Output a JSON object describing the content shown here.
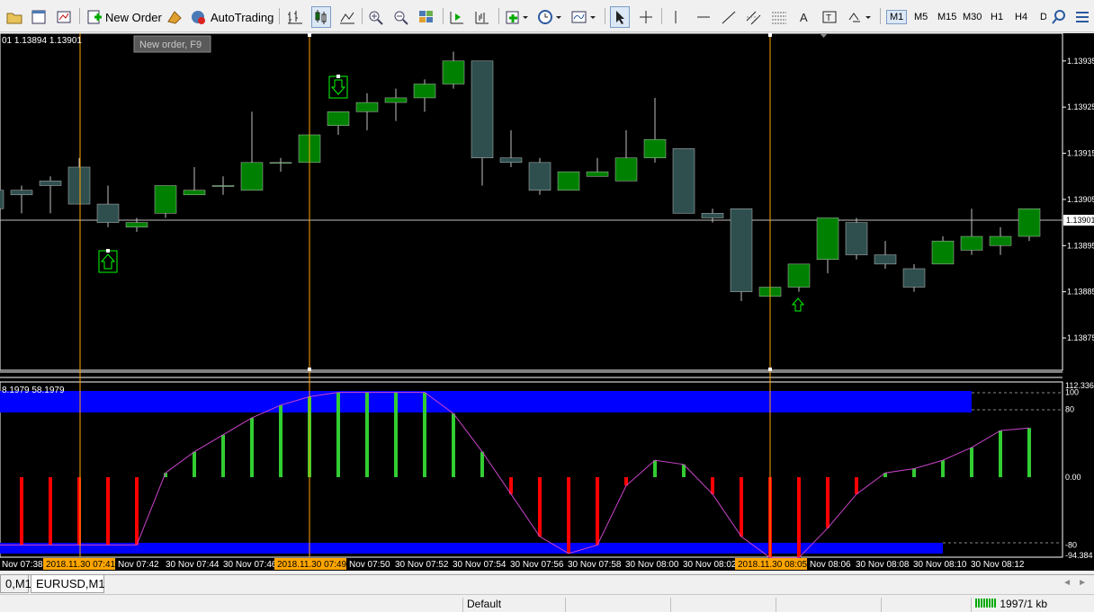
{
  "toolbar": {
    "new_order_label": "New Order",
    "autotrading_label": "AutoTrading",
    "timeframes": [
      "M1",
      "M5",
      "M15",
      "M30",
      "H1",
      "H4",
      "D"
    ],
    "active_timeframe": "M1"
  },
  "tooltip": "New order, F9",
  "chart": {
    "info_text": "01 1.13894 1.13901",
    "current_price": "1.13901",
    "price_labels": [
      "1.13935",
      "1.13925",
      "1.13915",
      "1.13905",
      "1.13895",
      "1.13885",
      "1.13875"
    ],
    "indicator_info": "8.1979 58.1979",
    "indicator_labels": [
      "112.336",
      "100",
      "80",
      "0.00",
      "-80",
      "-94.384"
    ],
    "time_labels": [
      "Nov 07:38",
      "Nov 07:42",
      "30 Nov 07:44",
      "30 Nov 07:46",
      "Nov 07:50",
      "30 Nov 07:52",
      "30 Nov 07:54",
      "30 Nov 07:56",
      "30 Nov 07:58",
      "30 Nov 08:00",
      "30 Nov 08:02",
      "Nov 08:06",
      "30 Nov 08:08",
      "30 Nov 08:10",
      "30 Nov 08:12"
    ],
    "highlighted_times": [
      "2018.11.30 07:41",
      "2018.11.30 07:49",
      "2018.11.30 08:05"
    ]
  },
  "tabs": [
    "0,M1",
    "EURUSD,M1"
  ],
  "status": {
    "profile": "Default",
    "traffic": "1997/1 kb"
  },
  "colors": {
    "bull": "#008000",
    "bear": "#2f4f4f",
    "band": "#0000ff",
    "hist_up": "#32cd32",
    "hist_down": "#ff0000",
    "vline": "#ffa500"
  },
  "chart_data": [
    {
      "type": "candlestick",
      "series": [
        {
          "name": "EURUSD,M1",
          "ohlc": [
            [
              1.13907,
              1.13907,
              1.13903,
              1.13903
            ],
            [
              1.13907,
              1.13908,
              1.13902,
              1.13906
            ],
            [
              1.13909,
              1.1391,
              1.13902,
              1.13908
            ],
            [
              1.13912,
              1.13914,
              1.13904,
              1.13904
            ],
            [
              1.13904,
              1.13908,
              1.13899,
              1.139
            ],
            [
              1.13899,
              1.13901,
              1.13898,
              1.139
            ],
            [
              1.13902,
              1.13908,
              1.13901,
              1.13908
            ],
            [
              1.13906,
              1.13912,
              1.13906,
              1.13907
            ],
            [
              1.13908,
              1.1391,
              1.13906,
              1.13908
            ],
            [
              1.13907,
              1.13924,
              1.13907,
              1.13913
            ],
            [
              1.13913,
              1.13914,
              1.13911,
              1.13913
            ],
            [
              1.13913,
              1.13919,
              1.13913,
              1.13919
            ],
            [
              1.13921,
              1.13923,
              1.13919,
              1.13924
            ],
            [
              1.13924,
              1.13928,
              1.1392,
              1.13926
            ],
            [
              1.13926,
              1.13929,
              1.13922,
              1.13927
            ],
            [
              1.13927,
              1.13931,
              1.13924,
              1.1393
            ],
            [
              1.1393,
              1.13937,
              1.13929,
              1.13935
            ],
            [
              1.13935,
              1.13935,
              1.13908,
              1.13914
            ],
            [
              1.13914,
              1.1392,
              1.13912,
              1.13913
            ],
            [
              1.13913,
              1.13914,
              1.13906,
              1.13907
            ],
            [
              1.13907,
              1.13911,
              1.13907,
              1.13911
            ],
            [
              1.1391,
              1.13914,
              1.1391,
              1.13911
            ],
            [
              1.13909,
              1.1392,
              1.13909,
              1.13914
            ],
            [
              1.13914,
              1.13927,
              1.13913,
              1.13918
            ],
            [
              1.13916,
              1.13916,
              1.13902,
              1.13902
            ],
            [
              1.13902,
              1.13903,
              1.139,
              1.13901
            ],
            [
              1.13903,
              1.13903,
              1.13883,
              1.13885
            ],
            [
              1.13884,
              1.13889,
              1.13883,
              1.13886
            ],
            [
              1.13886,
              1.13891,
              1.13885,
              1.13891
            ],
            [
              1.13892,
              1.13892,
              1.13889,
              1.13901
            ],
            [
              1.139,
              1.13901,
              1.13892,
              1.13893
            ],
            [
              1.13893,
              1.13896,
              1.1389,
              1.13891
            ],
            [
              1.1389,
              1.13891,
              1.13885,
              1.13886
            ],
            [
              1.13891,
              1.13897,
              1.13891,
              1.13896
            ],
            [
              1.13894,
              1.13903,
              1.13893,
              1.13897
            ],
            [
              1.13895,
              1.13899,
              1.13893,
              1.13897
            ],
            [
              1.13897,
              1.13903,
              1.13896,
              1.13903
            ]
          ]
        }
      ],
      "ylim": [
        1.13868,
        1.13941
      ],
      "grid": false
    },
    {
      "type": "bar",
      "series": [
        {
          "name": "histogram",
          "values": [
            -80,
            -80,
            -80,
            -80,
            -80,
            -80,
            5,
            30,
            50,
            70,
            85,
            95,
            100,
            100,
            100,
            100,
            75,
            30,
            -20,
            -70,
            -90,
            -80,
            -10,
            20,
            15,
            -20,
            -70,
            -95,
            -95,
            -60,
            -20,
            5,
            10,
            20,
            35,
            55,
            58
          ]
        }
      ],
      "ylim": [
        -94.384,
        112.336
      ],
      "levels": [
        100,
        80,
        0,
        -80
      ]
    }
  ]
}
